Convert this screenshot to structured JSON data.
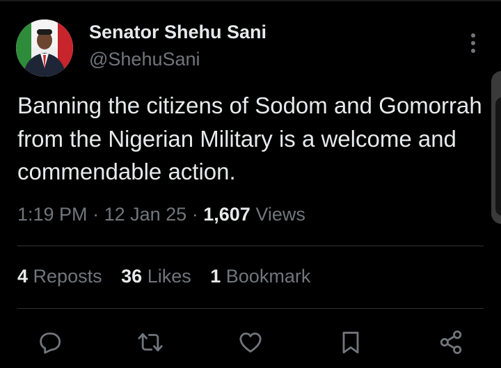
{
  "author": {
    "display_name": "Senator Shehu Sani",
    "handle": "@ShehuSani",
    "avatar_icon": "profile-photo"
  },
  "tweet": {
    "text": "Banning the citizens of Sodom and Gomorrah from the Nigerian Military is a welcome and commendable action.",
    "time": "1:19 PM",
    "date": "12 Jan 25",
    "separator": "·",
    "views_count": "1,607",
    "views_label": "Views"
  },
  "stats": {
    "reposts_count": "4",
    "reposts_label": "Reposts",
    "likes_count": "36",
    "likes_label": "Likes",
    "bookmarks_count": "1",
    "bookmarks_label": "Bookmark"
  },
  "actions": [
    "reply-icon",
    "repost-icon",
    "like-icon",
    "bookmark-icon",
    "share-icon"
  ],
  "colors": {
    "background": "#000000",
    "primary_text": "#e7e9ea",
    "secondary_text": "#71767b",
    "divider": "#2f3336"
  }
}
